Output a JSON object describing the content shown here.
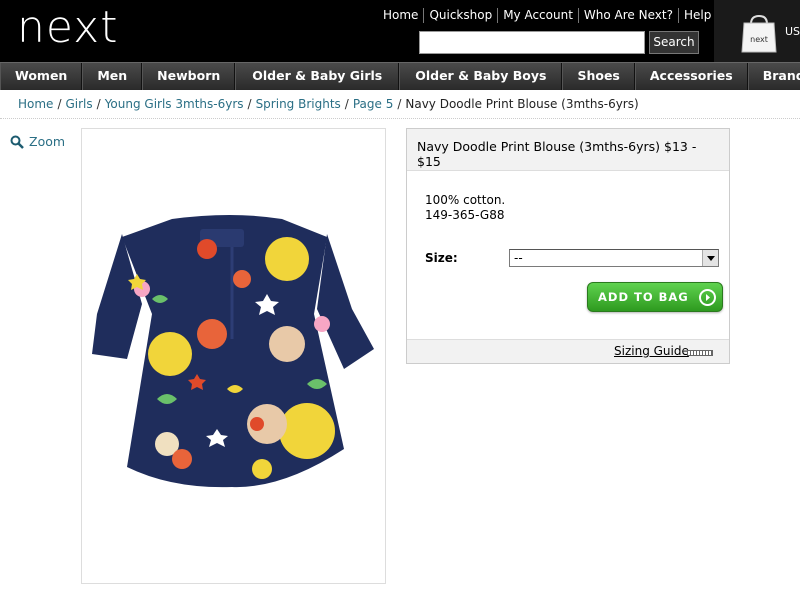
{
  "header": {
    "logo": "next",
    "links": [
      "Home",
      "Quickshop",
      "My Account",
      "Who Are Next?",
      "Help"
    ],
    "search_button": "Search",
    "search_placeholder": "",
    "bag_label": "next",
    "region": "US"
  },
  "nav": {
    "items": [
      "Women",
      "Men",
      "Newborn",
      "Older & Baby Girls",
      "Older & Baby Boys",
      "Shoes",
      "Accessories",
      "Brands & Sp"
    ]
  },
  "breadcrumb": {
    "items": [
      "Home",
      "Girls",
      "Young Girls 3mths-6yrs",
      "Spring Brights",
      "Page 5"
    ],
    "current": "Navy Doodle Print Blouse (3mths-6yrs)"
  },
  "zoom_label": "Zoom",
  "product": {
    "title": "Navy Doodle Print Blouse (3mths-6yrs)",
    "price": "$13 - $15",
    "material": "100% cotton.",
    "code": "149-365-G88",
    "size_label": "Size:",
    "size_value": "--",
    "add_button": "ADD TO BAG",
    "sizing_guide": "Sizing Guide"
  },
  "colors": {
    "header_bg": "#000000",
    "link_teal": "#2b6f85",
    "add_button_green": "#3cb22b",
    "blouse_navy": "#1f2d5c"
  }
}
